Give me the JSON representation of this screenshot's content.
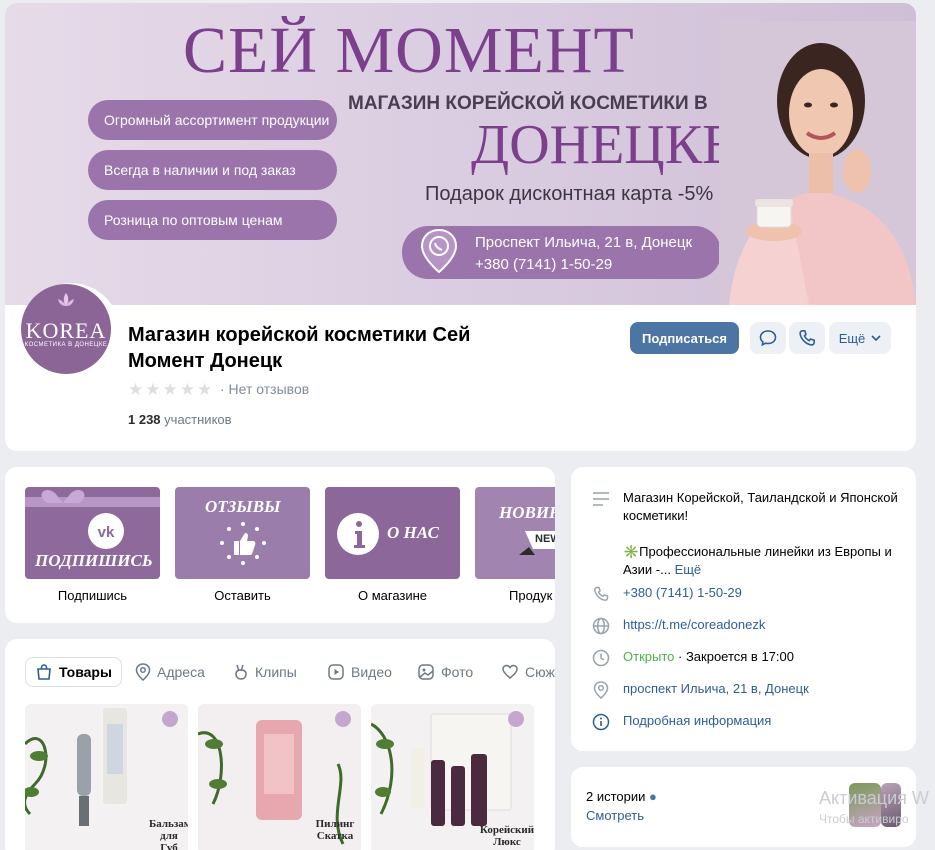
{
  "cover": {
    "title": "СЕЙ МОМЕНТ",
    "subtitle": "МАГАЗИН КОРЕЙСКОЙ КОСМЕТИКИ В",
    "city": "ДОНЕЦКЕ",
    "gift": "Подарок дисконтная карта -5%",
    "pills": [
      "Огромный ассортимент продукции",
      "Всегда в наличии и под заказ",
      "Розница по оптовым ценам"
    ],
    "address_line1": "Проспект Ильича, 21 в, Донецк",
    "address_line2": "+380 (7141) 1-50-29"
  },
  "avatar": {
    "brand": "KOREA",
    "brand_sub": "КОСМЕТИКА В ДОНЕЦКЕ"
  },
  "group": {
    "name": "Магазин корейской косметики Сей Момент Донецк",
    "reviews": "· Нет отзывов",
    "members_count": "1 238",
    "members_label": "участников",
    "rating": 0
  },
  "actions": {
    "subscribe": "Подписаться",
    "more": "Ещё"
  },
  "links": [
    {
      "tile_text": "ПОДПИШИСЬ",
      "label": "Подпишись"
    },
    {
      "tile_text": "ОТЗЫВЫ",
      "label": "Оставить"
    },
    {
      "tile_text": "О НАС",
      "label": "О магазине"
    },
    {
      "tile_text": "НОВИН",
      "badge": "NEW",
      "label": "Продук"
    }
  ],
  "info": {
    "description_1": "Магазин Корейской, Таиландской и Японской косметики!",
    "description_2": "✳️Профессиональные линейки из Европы и Азии -...",
    "more": "Ещё",
    "phone": "+380 (7141) 1-50-29",
    "site": "https://t.me/coreadonezk",
    "status_open": "Открыто",
    "status_close": "· Закроется в 17:00",
    "address": "проспект Ильича, 21 в, Донецк",
    "details": "Подробная информация"
  },
  "stories": {
    "count": "2 истории",
    "view": "Смотреть"
  },
  "tabs": [
    "Товары",
    "Адреса",
    "Клипы",
    "Видео",
    "Фото",
    "Сюж"
  ],
  "products": [
    {
      "tag_1": "Бальзам",
      "tag_2": "для",
      "tag_3": "Губ"
    },
    {
      "tag_1": "Пилинг",
      "tag_2": "Скатка",
      "tag_3": ""
    },
    {
      "tag_1": "Корейский",
      "tag_2": "Люкс",
      "tag_3": ""
    }
  ],
  "watermark": {
    "line1": "Активация W",
    "line2": "Чтобы активиро"
  },
  "colors": {
    "accent": "#4c75a3",
    "brand_purple": "#8d6a9b",
    "link": "#2d5d9a",
    "open": "#4bb34b"
  }
}
